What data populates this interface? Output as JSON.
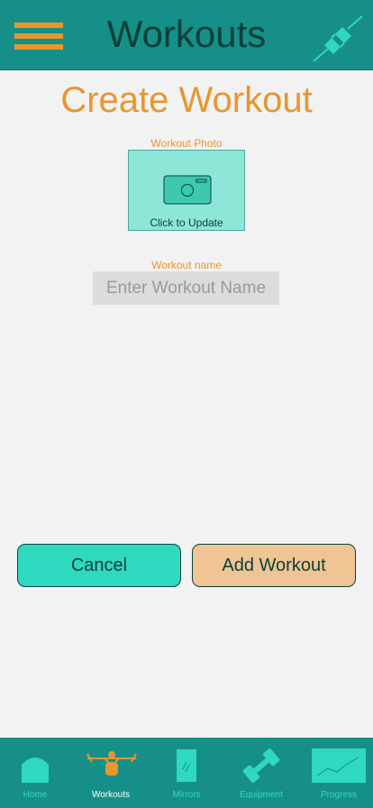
{
  "header": {
    "title": "Workouts"
  },
  "page": {
    "title": "Create Workout"
  },
  "photo": {
    "label": "Workout Photo",
    "caption": "Click to Update"
  },
  "workout_name": {
    "label": "Workout name",
    "value": "",
    "placeholder": "Enter Workout Name"
  },
  "buttons": {
    "cancel": "Cancel",
    "add": "Add Workout"
  },
  "tabs": [
    {
      "label": "Home",
      "icon": "home-icon",
      "active": false
    },
    {
      "label": "Workouts",
      "icon": "weightlifter-icon",
      "active": true
    },
    {
      "label": "Mirrors",
      "icon": "mirror-icon",
      "active": false
    },
    {
      "label": "Equipment",
      "icon": "dumbbell-icon",
      "active": false
    },
    {
      "label": "Progress",
      "icon": "chart-icon",
      "active": false
    }
  ],
  "colors": {
    "teal": "#168f88",
    "accent_orange": "#e8962e",
    "aqua": "#2fd9bf",
    "dark_text": "#0b3f3a",
    "peach": "#f0c493"
  }
}
